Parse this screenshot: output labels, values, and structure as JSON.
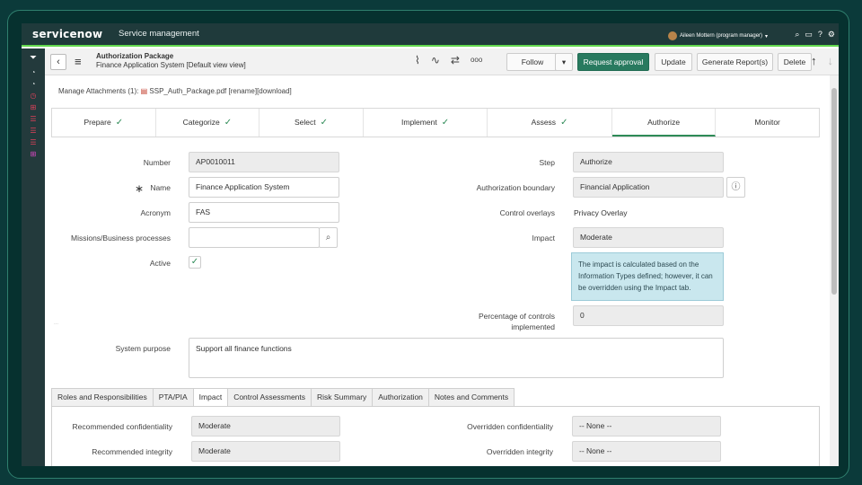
{
  "topbar": {
    "logo_text": "servicenow",
    "app_name": "Service management",
    "user_name": "Aileen Mottern (program manager)",
    "user_caret": "▾",
    "icons": [
      "search-icon",
      "chat-icon",
      "help-icon",
      "settings-icon"
    ],
    "icon_glyphs": {
      "search": "⌕",
      "chat": "▭",
      "help": "?",
      "settings": "⚙"
    }
  },
  "sidenav": {
    "icons": [
      "filter-icon",
      "gauge-icon",
      "gauge-icon",
      "clock-icon",
      "grid-icon",
      "list-icon",
      "list-icon",
      "list-icon",
      "grid-icon"
    ],
    "glyphs": {
      "filter": "⏷",
      "gauge": "◔",
      "clock": "◷",
      "grid": "⊞",
      "list": "☰"
    }
  },
  "form_header": {
    "back_glyph": "‹",
    "menu_glyph": "≡",
    "title": "Authorization Package",
    "subtitle": "Finance Application System [Default view view]",
    "icon_glyphs": {
      "attachment": "⌇",
      "activity": "∿",
      "settings": "⇄",
      "more": "ooo"
    },
    "follow_label": "Follow",
    "follow_caret": "▾",
    "request_approval_label": "Request approval",
    "update_label": "Update",
    "generate_report_label": "Generate Report(s)",
    "delete_label": "Delete",
    "up_glyph": "↑",
    "down_glyph": "↓"
  },
  "attachments": {
    "label": "Manage Attachments (1):",
    "pdf_glyph": "▤",
    "file_name": "SSP_Auth_Package.pdf",
    "rename": "[rename]",
    "download": "[download]"
  },
  "steps": [
    {
      "label": "Prepare",
      "done": true
    },
    {
      "label": "Categorize",
      "done": true
    },
    {
      "label": "Select",
      "done": true
    },
    {
      "label": "Implement",
      "done": true
    },
    {
      "label": "Assess",
      "done": true
    },
    {
      "label": "Authorize",
      "done": false
    },
    {
      "label": "Monitor",
      "done": false
    }
  ],
  "check_glyph": "✓",
  "form": {
    "number_label": "Number",
    "number_value": "AP0010011",
    "required_marker": "∗",
    "name_label": "Name",
    "name_value": "Finance Application System",
    "acronym_label": "Acronym",
    "acronym_value": "FAS",
    "missions_label": "Missions/Business processes",
    "missions_value": "",
    "search_glyph": "⌕",
    "active_label": "Active",
    "active_checked": true,
    "step_label": "Step",
    "step_value": "Authorize",
    "auth_boundary_label": "Authorization boundary",
    "auth_boundary_value": "Financial Application",
    "info_glyph": "ⓘ",
    "control_overlays_label": "Control overlays",
    "control_overlays_value": "Privacy Overlay",
    "impact_label": "Impact",
    "impact_value": "Moderate",
    "impact_info": "The impact is calculated based on the Information Types defined; however, it can be overridden using the Impact tab.",
    "pct_label_line1": "Percentage of controls",
    "pct_label_line2": "implemented",
    "pct_value": "0",
    "system_purpose_label": "System purpose",
    "system_purpose_value": "Support all finance functions",
    "dots": "..."
  },
  "tabs": [
    {
      "label": "Roles and Responsibilities",
      "active": false
    },
    {
      "label": "PTA/PIA",
      "active": false
    },
    {
      "label": "Impact",
      "active": true
    },
    {
      "label": "Control Assessments",
      "active": false
    },
    {
      "label": "Risk Summary",
      "active": false
    },
    {
      "label": "Authorization",
      "active": false
    },
    {
      "label": "Notes and Comments",
      "active": false
    }
  ],
  "impact_tab": {
    "rec_conf_label": "Recommended confidentiality",
    "rec_conf_value": "Moderate",
    "rec_int_label": "Recommended integrity",
    "rec_int_value": "Moderate",
    "ovr_conf_label": "Overridden confidentiality",
    "ovr_conf_value": "-- None --",
    "ovr_int_label": "Overridden integrity",
    "ovr_int_value": "-- None --"
  }
}
